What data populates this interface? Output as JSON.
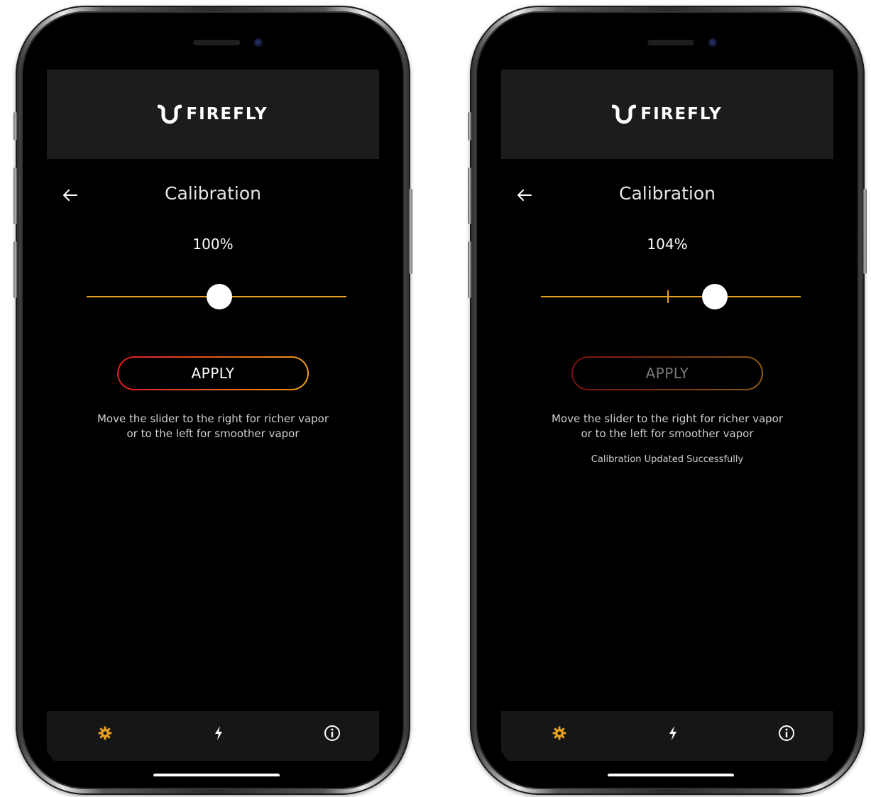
{
  "colors": {
    "accent": "#e8a020",
    "button_gradient_start": "#e01a22",
    "button_gradient_end": "#ef9a1a",
    "header_bg": "#1c1c1c",
    "screen_bg": "#000000",
    "settings_icon_active": "#e8a020"
  },
  "screens": [
    {
      "brand": "FIREFLY",
      "brand_icon": "firefly-logo-mark",
      "back_icon": "arrow-left-icon",
      "page_title": "Calibration",
      "percent_label": "100%",
      "slider": {
        "value_percent": 51,
        "default_mark_percent": null
      },
      "apply_label": "APPLY",
      "apply_enabled": true,
      "hint_line_1": "Move the slider to the right for richer vapor",
      "hint_line_2": "or to the left for smoother vapor",
      "status_message": "",
      "tabs": [
        {
          "icon": "gear-icon",
          "active": true
        },
        {
          "icon": "lightning-icon",
          "active": false
        },
        {
          "icon": "info-icon",
          "active": false
        }
      ]
    },
    {
      "brand": "FIREFLY",
      "brand_icon": "firefly-logo-mark",
      "back_icon": "arrow-left-icon",
      "page_title": "Calibration",
      "percent_label": "104%",
      "slider": {
        "value_percent": 67,
        "default_mark_percent": 49
      },
      "apply_label": "APPLY",
      "apply_enabled": false,
      "hint_line_1": "Move the slider to the right for richer vapor",
      "hint_line_2": "or to the left for smoother vapor",
      "status_message": "Calibration Updated Successfully",
      "tabs": [
        {
          "icon": "gear-icon",
          "active": true
        },
        {
          "icon": "lightning-icon",
          "active": false
        },
        {
          "icon": "info-icon",
          "active": false
        }
      ]
    }
  ]
}
